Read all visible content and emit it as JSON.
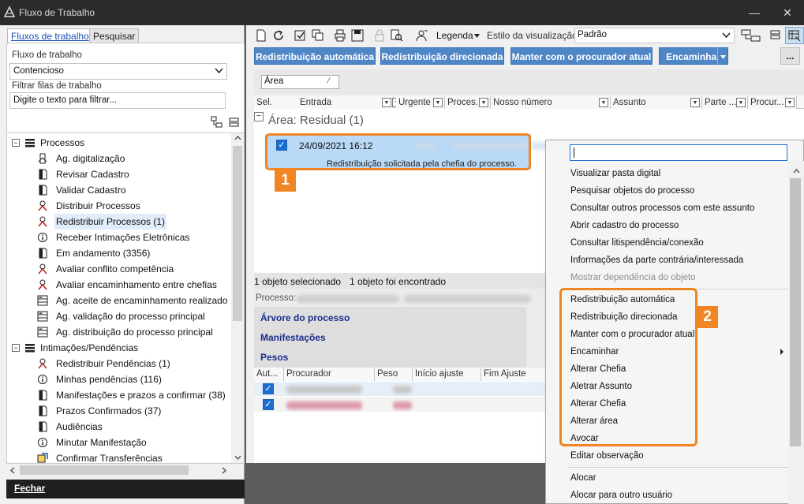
{
  "window": {
    "title": "Fluxo de Trabalho",
    "minimize_icon": "minimize-icon",
    "close_icon": "close-icon"
  },
  "left": {
    "tabs": [
      {
        "label": "Fluxos de trabalho"
      },
      {
        "label": "Pesquisar"
      }
    ],
    "workflow_label": "Fluxo de trabalho",
    "workflow_value": "Contencioso",
    "filter_label": "Filtrar filas de trabalho",
    "filter_placeholder": "Digite o texto para filtrar...",
    "tree": [
      {
        "label": "Processos",
        "level": 0,
        "expander": "⊟",
        "icon": "list-icon"
      },
      {
        "label": "Ag. digitalização",
        "level": 1,
        "icon": "scan-icon"
      },
      {
        "label": "Revisar Cadastro",
        "level": 1,
        "icon": "document-icon"
      },
      {
        "label": "Validar Cadastro",
        "level": 1,
        "icon": "document-icon"
      },
      {
        "label": "Distribuir Processos",
        "level": 1,
        "icon": "person-icon"
      },
      {
        "label": "Redistribuir Processos (1)",
        "level": 1,
        "icon": "person-icon",
        "selected": true
      },
      {
        "label": "Receber Intimações Eletrônicas",
        "level": 1,
        "icon": "info-icon"
      },
      {
        "label": "Em andamento (3356)",
        "level": 1,
        "icon": "document-icon"
      },
      {
        "label": "Avaliar conflito competência",
        "level": 1,
        "icon": "person-icon"
      },
      {
        "label": "Avaliar encaminhamento entre chefias",
        "level": 1,
        "icon": "person-icon"
      },
      {
        "label": "Ag. aceite de encaminhamento realizado",
        "level": 1,
        "icon": "grid-icon"
      },
      {
        "label": "Ag. validação do processo principal",
        "level": 1,
        "icon": "grid-icon"
      },
      {
        "label": "Ag. distribuição do processo principal",
        "level": 1,
        "icon": "grid-icon"
      },
      {
        "label": "Intimações/Pendências",
        "level": 0,
        "expander": "⊟",
        "icon": "list-icon"
      },
      {
        "label": "Redistribuir Pendências (1)",
        "level": 1,
        "icon": "person-icon"
      },
      {
        "label": "Minhas pendências (116)",
        "level": 1,
        "icon": "info-icon"
      },
      {
        "label": "Manifestações e prazos a confirmar (38)",
        "level": 1,
        "icon": "document-icon"
      },
      {
        "label": "Prazos Confirmados (37)",
        "level": 1,
        "icon": "document-icon"
      },
      {
        "label": "Audiências",
        "level": 1,
        "icon": "document-icon"
      },
      {
        "label": "Minutar Manifestação",
        "level": 1,
        "icon": "info-icon"
      },
      {
        "label": "Confirmar Transferências",
        "level": 1,
        "icon": "transfer-icon"
      }
    ],
    "close_button": "Fechar"
  },
  "toolbar": {
    "legend_label": "Legenda",
    "style_label": "Estilo da visualização",
    "style_value": "Padrão"
  },
  "actions": [
    {
      "label": "Redistribuição automática"
    },
    {
      "label": "Redistribuição direcionada"
    },
    {
      "label": "Manter com o procurador atual"
    },
    {
      "label": "Encaminhar"
    }
  ],
  "more_label": "...",
  "group_chip": "Área",
  "columns": [
    "Sel.",
    "Entrada",
    "V",
    "Urgente",
    "Proces...",
    "Nosso número",
    "Assunto",
    "Parte ...",
    "Procur..."
  ],
  "group_header": "Área: Residual  (1)",
  "row": {
    "date": "24/09/2021 16:12",
    "note": "Redistribuição solicitada pela chefia do processo."
  },
  "badge1": "1",
  "badge2": "2",
  "status": {
    "selected": "1 objeto selecionado",
    "found": "1 objeto foi encontrado"
  },
  "detail": {
    "process_label": "Processo:",
    "links": [
      "Árvore do processo",
      "Manifestações",
      "Pesos"
    ]
  },
  "subgrid_columns": [
    "Aut...",
    "Procurador",
    "Peso",
    "Início ajuste",
    "Fim Ajuste"
  ],
  "menu": {
    "items_top": [
      {
        "label": "Visualizar pasta digital"
      },
      {
        "label": "Pesquisar objetos do processo"
      },
      {
        "label": "Consultar outros processos com este assunto"
      },
      {
        "label": "Abrir cadastro do processo"
      },
      {
        "label": "Consultar litispendência/conexão"
      },
      {
        "label": "Informações da parte contrária/interessada"
      },
      {
        "label": "Mostrar dependência do objeto",
        "disabled": true
      }
    ],
    "items_mid": [
      {
        "label": "Redistribuição automática"
      },
      {
        "label": "Redistribuição direcionada"
      },
      {
        "label": "Manter com o procurador atual"
      },
      {
        "label": "Encaminhar",
        "submenu": true
      },
      {
        "label": "Alterar Chefia"
      },
      {
        "label": "Aletrar Assunto"
      },
      {
        "label": "Alterar Chefia"
      },
      {
        "label": "Alterar área"
      },
      {
        "label": "Avocar"
      }
    ],
    "items_bottom": [
      {
        "label": "Editar observação"
      },
      {
        "label": "Alocar"
      },
      {
        "label": "Alocar para outro usuário"
      }
    ]
  }
}
